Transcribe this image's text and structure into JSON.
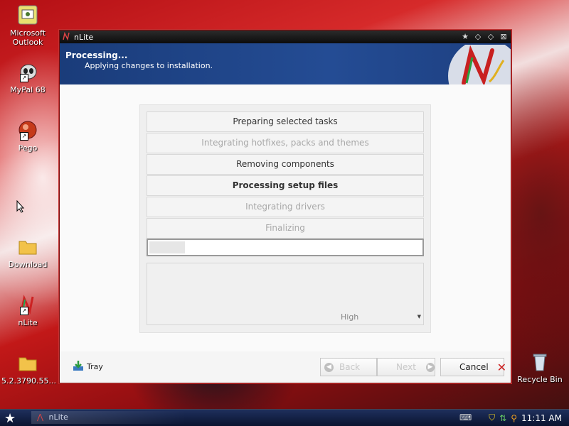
{
  "desktop": {
    "icons": [
      {
        "label": "Microsoft Outlook",
        "icon": "outlook-icon"
      },
      {
        "label": "MyPal 68",
        "icon": "mypal-icon"
      },
      {
        "label": "Pego",
        "icon": "pego-icon"
      },
      {
        "label": "Download",
        "icon": "folder-icon"
      },
      {
        "label": "nLite",
        "icon": "nlite-icon"
      },
      {
        "label": "5.2.3790.55...",
        "icon": "folder-icon"
      },
      {
        "label": "Recycle Bin",
        "icon": "recycle-bin-icon"
      }
    ]
  },
  "window": {
    "title": "nLite",
    "header_title": "Processing...",
    "header_subtitle": "Applying changes to installation.",
    "tasks": [
      {
        "label": "Preparing selected tasks",
        "state": "done"
      },
      {
        "label": "Integrating hotfixes, packs and themes",
        "state": "skipped"
      },
      {
        "label": "Removing components",
        "state": "done"
      },
      {
        "label": "Processing setup files",
        "state": "active"
      },
      {
        "label": "Integrating drivers",
        "state": "pending"
      },
      {
        "label": "Finalizing",
        "state": "pending"
      }
    ],
    "progress_fraction": 0.13,
    "priority": "High",
    "buttons": {
      "tray": "Tray",
      "back": "Back",
      "next": "Next",
      "cancel": "Cancel"
    }
  },
  "taskbar": {
    "task": "nLite",
    "clock": "11:11 AM"
  },
  "colors": {
    "header_blue": "#244c94",
    "titlebar": "#0c0c0c",
    "desktop_red": "#c21818"
  }
}
